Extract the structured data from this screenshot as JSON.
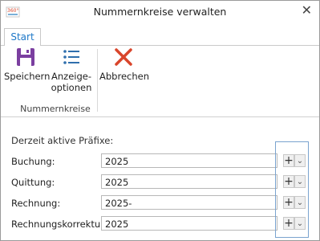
{
  "window": {
    "title": "Nummernkreise verwalten",
    "logo_text": "360°"
  },
  "tabs": [
    {
      "label": "Start",
      "active": true
    }
  ],
  "ribbon": {
    "buttons": [
      {
        "label_line1": "Speichern",
        "label_line2": "",
        "icon": "save-icon"
      },
      {
        "label_line1": "Anzeige-",
        "label_line2": "optionen",
        "icon": "list-icon"
      },
      {
        "label_line1": "Abbrechen",
        "label_line2": "",
        "icon": "cancel-icon"
      }
    ],
    "group_label": "Nummernkreise"
  },
  "section_title": "Derzeit aktive Präfixe:",
  "prefixes": [
    {
      "label": "Buchung:",
      "value": "2025"
    },
    {
      "label": "Quittung:",
      "value": "2025"
    },
    {
      "label": "Rechnung:",
      "value": "2025-"
    },
    {
      "label": "Rechnungskorrektur:",
      "value": "2025"
    }
  ],
  "row_buttons": {
    "add": "+",
    "dropdown": "⌄"
  },
  "colors": {
    "accent": "#1e78c8",
    "save": "#7b3fa0",
    "cancel": "#d9452b",
    "highlight": "#7aa3cf"
  }
}
